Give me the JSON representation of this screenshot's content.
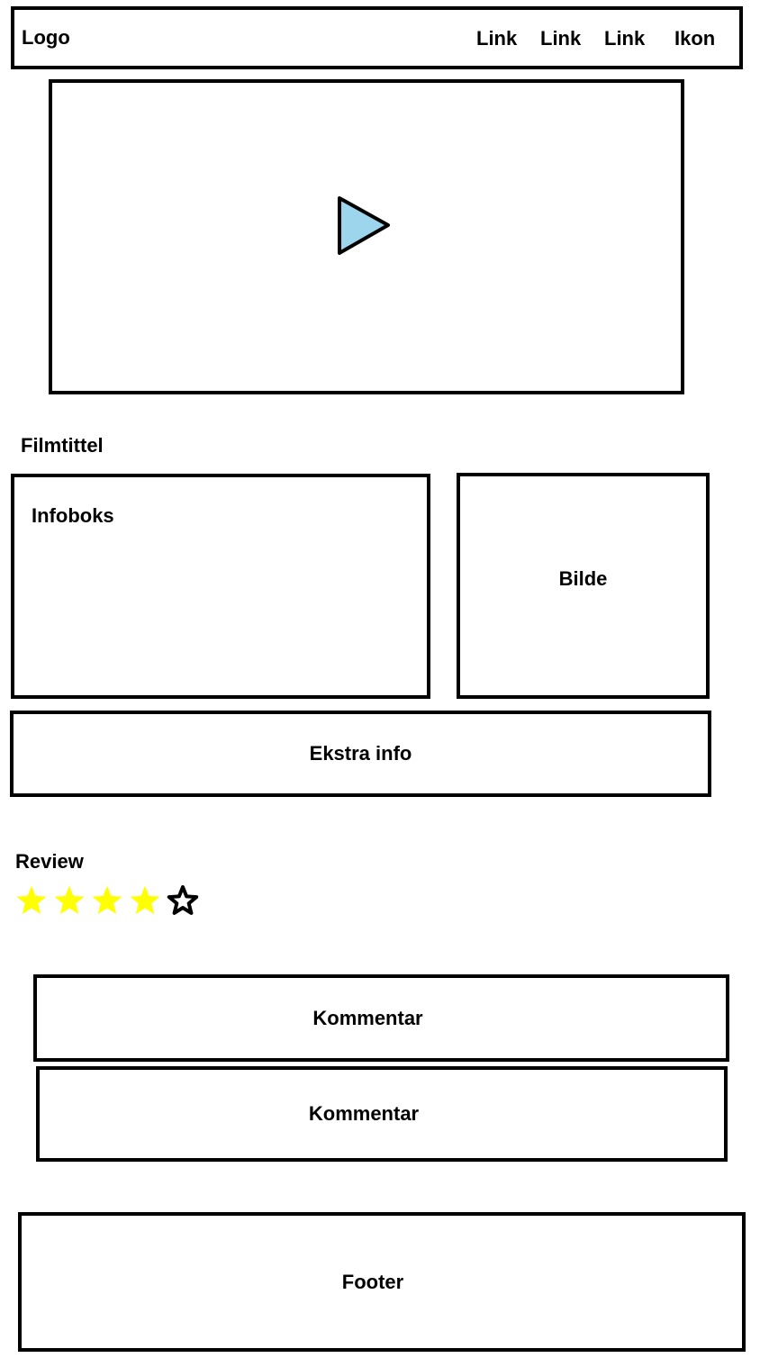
{
  "header": {
    "logo": "Logo",
    "links": [
      "Link",
      "Link",
      "Link"
    ],
    "icon_label": "Ikon"
  },
  "video": {
    "play_icon": "play-icon",
    "play_color": "#9dd5ec"
  },
  "movie": {
    "title": "Filmtittel",
    "infobox_label": "Infoboks",
    "image_label": "Bilde",
    "extra_info_label": "Ekstra info"
  },
  "review": {
    "heading": "Review",
    "rating": 4,
    "max_rating": 5,
    "star_color": "#ffff00"
  },
  "comments": [
    "Kommentar",
    "Kommentar"
  ],
  "footer": {
    "label": "Footer"
  }
}
